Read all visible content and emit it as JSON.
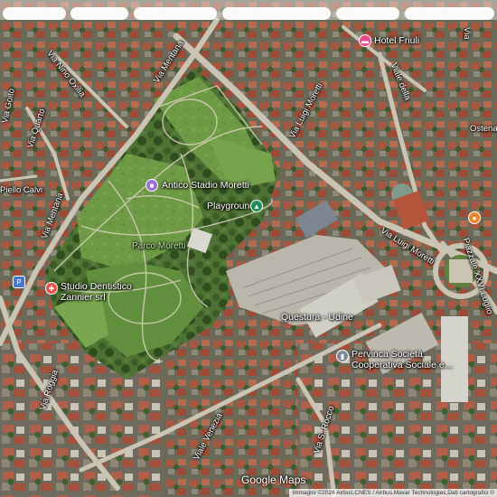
{
  "labels": {
    "via_nino_oxilia": "Via Nino Oxilia",
    "via_mentana_top": "Via Mentana",
    "via_mentana_left": "Via Mentana",
    "via_quarto": "Via Quarto",
    "via_goito": "Via Goito",
    "piello_calvi": "Piello Calvi",
    "via_luigi_moretti_top": "Via Luigi Moretti",
    "via_luigi_moretti_mid": "Via Luigi Moretti",
    "viale_della": "Viale della",
    "ostena": "Ostena",
    "piazzale_luglio": "Piazzale XXVI Luglio",
    "via_roggia": "Via Roggia",
    "viale_venezia": "Viale Venezia",
    "via_s_rocco": "Via S. Rocco",
    "parco_moretti": "Parco Moretti",
    "via_right_edge": "Via"
  },
  "pois": {
    "hotel_friuli": {
      "label": "Hotel Friuli",
      "color": "#e64a8a",
      "icon": "bed-icon"
    },
    "antico_stadio": {
      "label": "Antico Stadio Moretti",
      "color": "#9c6ed6",
      "icon": "camera-icon"
    },
    "playground": {
      "label": "Playground",
      "color": "#1e8e5a",
      "icon": "playground-icon"
    },
    "studio_dentistico": {
      "label": "Studio Dentistico\nZannier srl",
      "color": "#e5534b",
      "icon": "tooth-icon"
    },
    "questura": {
      "label": "Questura - Udine",
      "color": "#7a8a99",
      "icon": "building-icon"
    },
    "pervinca": {
      "label": "Pervinca Società\nCooperativa Sociale e...",
      "color": "#7a8a99",
      "icon": "building-icon"
    },
    "orange_poi": {
      "label": "",
      "color": "#e8872a",
      "icon": "shop-icon"
    },
    "parking": {
      "label": "P",
      "color": "#4a78c8",
      "icon": "parking-icon"
    }
  },
  "brand": "Google Maps",
  "attribution": "Immagini ©2026 Airbus,CNES / Airbus,Maxar Technologies,Dati cartografici ©"
}
